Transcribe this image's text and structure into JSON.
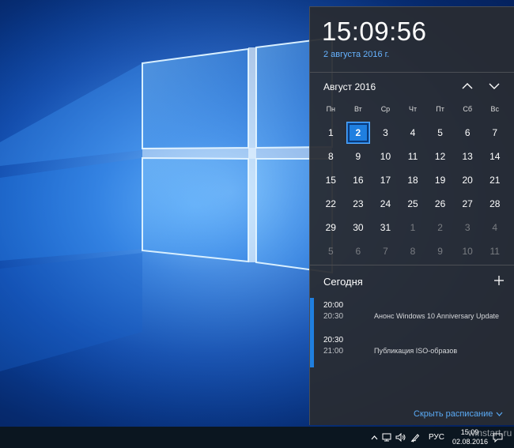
{
  "flyout": {
    "time": "15:09:56",
    "date_long": "2 августа 2016 г.",
    "month_label": "Август 2016",
    "weekdays": [
      "Пн",
      "Вт",
      "Ср",
      "Чт",
      "Пт",
      "Сб",
      "Вс"
    ],
    "weeks": [
      [
        {
          "d": "1"
        },
        {
          "d": "2",
          "today": true
        },
        {
          "d": "3"
        },
        {
          "d": "4"
        },
        {
          "d": "5"
        },
        {
          "d": "6"
        },
        {
          "d": "7"
        }
      ],
      [
        {
          "d": "8"
        },
        {
          "d": "9"
        },
        {
          "d": "10"
        },
        {
          "d": "11"
        },
        {
          "d": "12"
        },
        {
          "d": "13"
        },
        {
          "d": "14"
        }
      ],
      [
        {
          "d": "15"
        },
        {
          "d": "16"
        },
        {
          "d": "17"
        },
        {
          "d": "18"
        },
        {
          "d": "19"
        },
        {
          "d": "20"
        },
        {
          "d": "21"
        }
      ],
      [
        {
          "d": "22"
        },
        {
          "d": "23"
        },
        {
          "d": "24"
        },
        {
          "d": "25"
        },
        {
          "d": "26"
        },
        {
          "d": "27"
        },
        {
          "d": "28"
        }
      ],
      [
        {
          "d": "29"
        },
        {
          "d": "30"
        },
        {
          "d": "31"
        },
        {
          "d": "1",
          "dim": true
        },
        {
          "d": "2",
          "dim": true
        },
        {
          "d": "3",
          "dim": true
        },
        {
          "d": "4",
          "dim": true
        }
      ],
      [
        {
          "d": "5",
          "dim": true
        },
        {
          "d": "6",
          "dim": true
        },
        {
          "d": "7",
          "dim": true
        },
        {
          "d": "8",
          "dim": true
        },
        {
          "d": "9",
          "dim": true
        },
        {
          "d": "10",
          "dim": true
        },
        {
          "d": "11",
          "dim": true
        }
      ]
    ],
    "agenda_title": "Сегодня",
    "events": [
      {
        "start": "20:00",
        "end": "20:30",
        "title": "Анонс Windows 10 Anniversary Update"
      },
      {
        "start": "20:30",
        "end": "21:00",
        "title": "Публикация ISO-образов"
      }
    ],
    "hide_label": "Скрыть расписание"
  },
  "taskbar": {
    "language": "РУС",
    "clock_time": "15:09",
    "clock_date": "02.08.2016",
    "watermark": "winstart.ru"
  },
  "icons": [
    "chevron-up-icon",
    "chevron-down-icon",
    "plus-icon",
    "tray-overflow-icon",
    "network-icon",
    "volume-icon",
    "pen-icon",
    "notification-icon",
    "windows-logo"
  ],
  "colors": {
    "accent": "#1f7fe0",
    "link": "#5aaaf5",
    "flyout_bg": "#282c32",
    "taskbar_bg": "#0b1620"
  }
}
